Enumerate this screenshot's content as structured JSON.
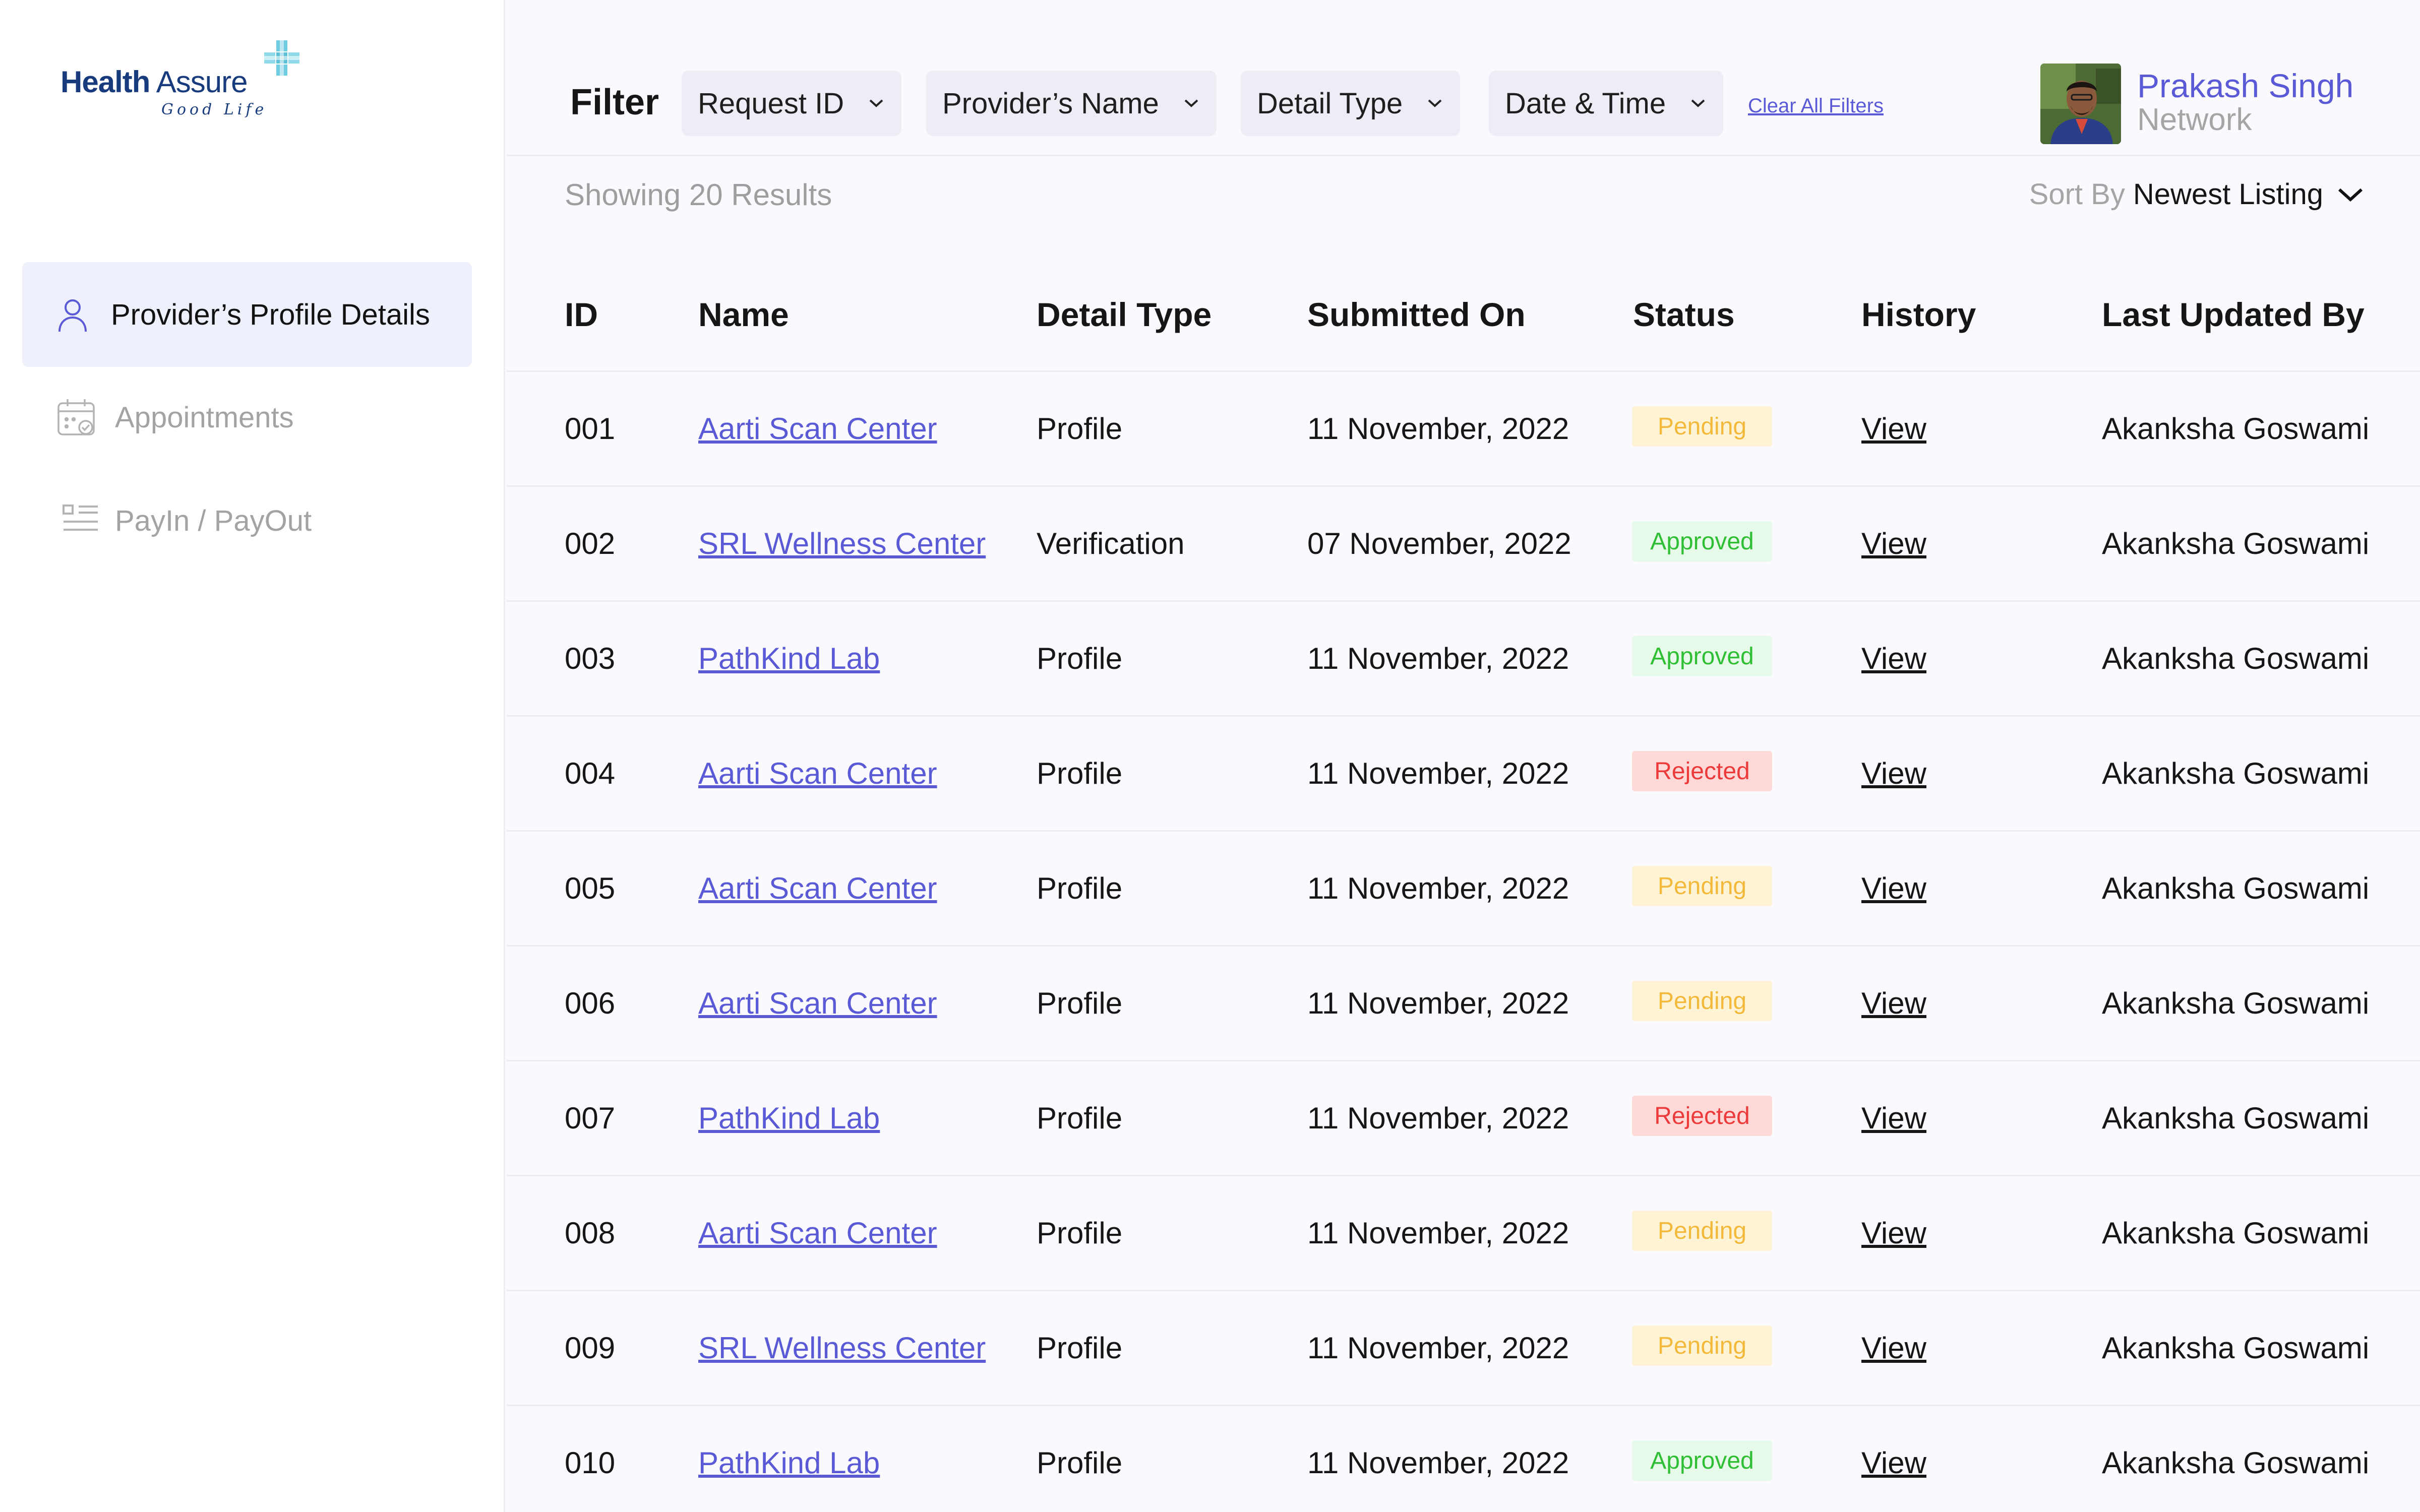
{
  "brand": {
    "name_bold": "Health",
    "name_regular": "Assure",
    "tagline": "Good Life"
  },
  "sidebar": {
    "items": [
      {
        "label": "Provider’s Profile Details",
        "icon": "user-icon",
        "active": true
      },
      {
        "label": "Appointments",
        "icon": "calendar-icon",
        "active": false
      },
      {
        "label": "PayIn / PayOut",
        "icon": "list-icon",
        "active": false
      }
    ]
  },
  "filters": {
    "title": "Filter",
    "buttons": [
      "Request ID",
      "Provider’s Name",
      "Detail Type",
      "Date & Time"
    ],
    "clear_label": "Clear All Filters"
  },
  "user": {
    "name": "Prakash Singh",
    "role": "Network"
  },
  "results": {
    "summary": "Showing 20 Results",
    "sort_label": "Sort By",
    "sort_value": "Newest Listing"
  },
  "table": {
    "columns": [
      "ID",
      "Name",
      "Detail Type",
      "Submitted On",
      "Status",
      "History",
      "Last Updated By"
    ],
    "rows": [
      {
        "id": "001",
        "name": "Aarti Scan Center",
        "type": "Profile",
        "date": "11 November, 2022",
        "status": "Pending",
        "history": "View",
        "updated_by": "Akanksha Goswami"
      },
      {
        "id": "002",
        "name": "SRL Wellness Center",
        "type": "Verification",
        "date": "07 November, 2022",
        "status": "Approved",
        "history": "View",
        "updated_by": "Akanksha Goswami"
      },
      {
        "id": "003",
        "name": "PathKind Lab",
        "type": "Profile",
        "date": "11 November, 2022",
        "status": "Approved",
        "history": "View",
        "updated_by": "Akanksha Goswami"
      },
      {
        "id": "004",
        "name": "Aarti Scan Center",
        "type": "Profile",
        "date": "11 November, 2022",
        "status": "Rejected",
        "history": "View",
        "updated_by": "Akanksha Goswami"
      },
      {
        "id": "005",
        "name": "Aarti Scan Center",
        "type": "Profile",
        "date": "11 November, 2022",
        "status": "Pending",
        "history": "View",
        "updated_by": "Akanksha Goswami"
      },
      {
        "id": "006",
        "name": "Aarti Scan Center",
        "type": "Profile",
        "date": "11 November, 2022",
        "status": "Pending",
        "history": "View",
        "updated_by": "Akanksha Goswami"
      },
      {
        "id": "007",
        "name": "PathKind Lab",
        "type": "Profile",
        "date": "11 November, 2022",
        "status": "Rejected",
        "history": "View",
        "updated_by": "Akanksha Goswami"
      },
      {
        "id": "008",
        "name": "Aarti Scan Center",
        "type": "Profile",
        "date": "11 November, 2022",
        "status": "Pending",
        "history": "View",
        "updated_by": "Akanksha Goswami"
      },
      {
        "id": "009",
        "name": "SRL Wellness Center",
        "type": "Profile",
        "date": "11 November, 2022",
        "status": "Pending",
        "history": "View",
        "updated_by": "Akanksha Goswami"
      },
      {
        "id": "010",
        "name": "PathKind Lab",
        "type": "Profile",
        "date": "11 November, 2022",
        "status": "Approved",
        "history": "View",
        "updated_by": "Akanksha Goswami"
      }
    ]
  },
  "colors": {
    "accent": "#5a5ad6",
    "brand": "#173b7c",
    "pending": "#f2b93b",
    "approved": "#2fbf34",
    "rejected": "#ec3a3a"
  }
}
